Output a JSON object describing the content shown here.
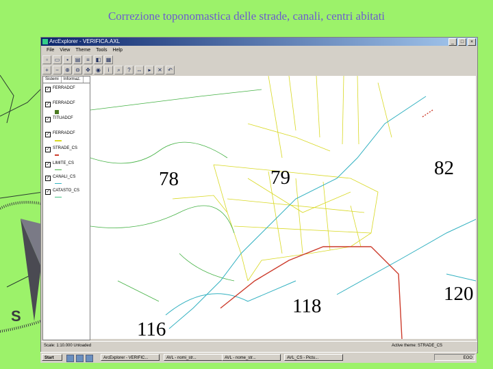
{
  "slide": {
    "title": "Correzione toponomastica delle strade, canali, centri abitati"
  },
  "window": {
    "title": "ArcExplorer - VERIFICA.AXL",
    "menu": [
      "File",
      "View",
      "Theme",
      "Tools",
      "Help"
    ],
    "toolbar_top": [
      "new-icon",
      "open-icon",
      "save-icon",
      "print-icon",
      "layers-icon",
      "properties-icon",
      "table-icon"
    ],
    "toolbar_bottom": [
      "add-layer-icon",
      "remove-layer-icon",
      "zoom-in-icon",
      "zoom-out-icon",
      "pan-icon",
      "full-extent-icon",
      "identify-icon",
      "find-icon",
      "query-icon",
      "measure-icon",
      "select-icon",
      "clear-icon",
      "previous-icon"
    ],
    "toc_tabs": [
      "Sistemi",
      "Informaz."
    ],
    "layers": [
      {
        "name": "FERRADCF",
        "checked": true,
        "color": "#7a8a2a"
      },
      {
        "name": "FERRADCF",
        "checked": true,
        "color": "#4b7a22"
      },
      {
        "name": "TITUADCF",
        "checked": true,
        "color": ""
      },
      {
        "name": "FERRADCF",
        "checked": true,
        "color": "#d8d820"
      },
      {
        "name": "STRADE_CS",
        "checked": true,
        "color": "#cc3a2a"
      },
      {
        "name": "LIMITE_CS",
        "checked": true,
        "color": "#40b040"
      },
      {
        "name": "CANALI_CS",
        "checked": true,
        "color": "#30b0c0"
      },
      {
        "name": "CATASTO_CS",
        "checked": true,
        "color": "#40c080"
      }
    ],
    "map_labels": [
      "78",
      "79",
      "82",
      "118",
      "120",
      "116"
    ],
    "status_left": "Scale: 1:10.000 Unloaded",
    "status_right": "Active theme: STRADE_CS"
  },
  "taskbar": {
    "start": "Start",
    "tasks": [
      "ArcExplorer - VERIFIC...",
      "AVL - nomi_str...",
      "AVL - nome_str...",
      "AVL_CS - Pictu..."
    ],
    "clock": "EOO"
  },
  "colors": {
    "background": "#9cf26a",
    "title": "#6b5bd0",
    "road": "#cc3a2a",
    "field": "#d8d820",
    "canal": "#30b0c0"
  }
}
